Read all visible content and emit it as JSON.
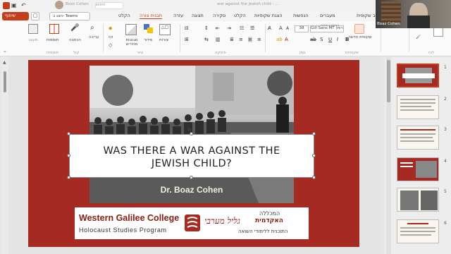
{
  "titlebar": {
    "user": "Boaz Cohen",
    "doc_title": "war against the jewish child - ...",
    "search": "חיפוש"
  },
  "ribbon_tabs": [
    "עיצוב שקופית",
    "מעברים",
    "הנפשות",
    "הצגת שקופיות",
    "הקלט",
    "סקירה",
    "תצוגה",
    "עזרה",
    "תבנית צורה",
    "הקלט"
  ],
  "share_button": "שיתוף",
  "teams_button": "הצג ב- Teams",
  "font": {
    "name": "Gill Sans MT (כותרות)",
    "size": "38"
  },
  "ribbon_labels": {
    "new_slide": "שקופית חדשה",
    "reuse": "שימוש חוזר",
    "shapes": "צורות",
    "arrange": "סידור",
    "quick_styles": "סגנונות מהירים",
    "dictate": "הכתבה",
    "addins": "תוספות",
    "designer": "מעצב",
    "editing": "עריכה",
    "group_slides": "שקופיות",
    "group_font": "גופן",
    "group_paragraph": "פיסקה",
    "group_drawing": "ציור",
    "group_voice": "קול",
    "group_addins": "תוספות",
    "group_clipboard": "לוח"
  },
  "slide": {
    "title_line1": "WAS THERE A WAR AGAINST THE",
    "title_line2": "JEWISH CHILD?",
    "author": "Dr. Boaz Cohen",
    "college": "Western Galilee College",
    "program": "Holocaust Studies Program",
    "heb_college": "המכללה",
    "heb_academic": "האקדמית",
    "heb_program": "התוכנית ללימודי השואה"
  },
  "video_label": "Boaz Cohen",
  "thumbnails": [
    "1",
    "2",
    "3",
    "4",
    "5",
    "6"
  ],
  "colors": {
    "slide_red": "#a52b22",
    "accent_orange": "#c43e1c"
  }
}
